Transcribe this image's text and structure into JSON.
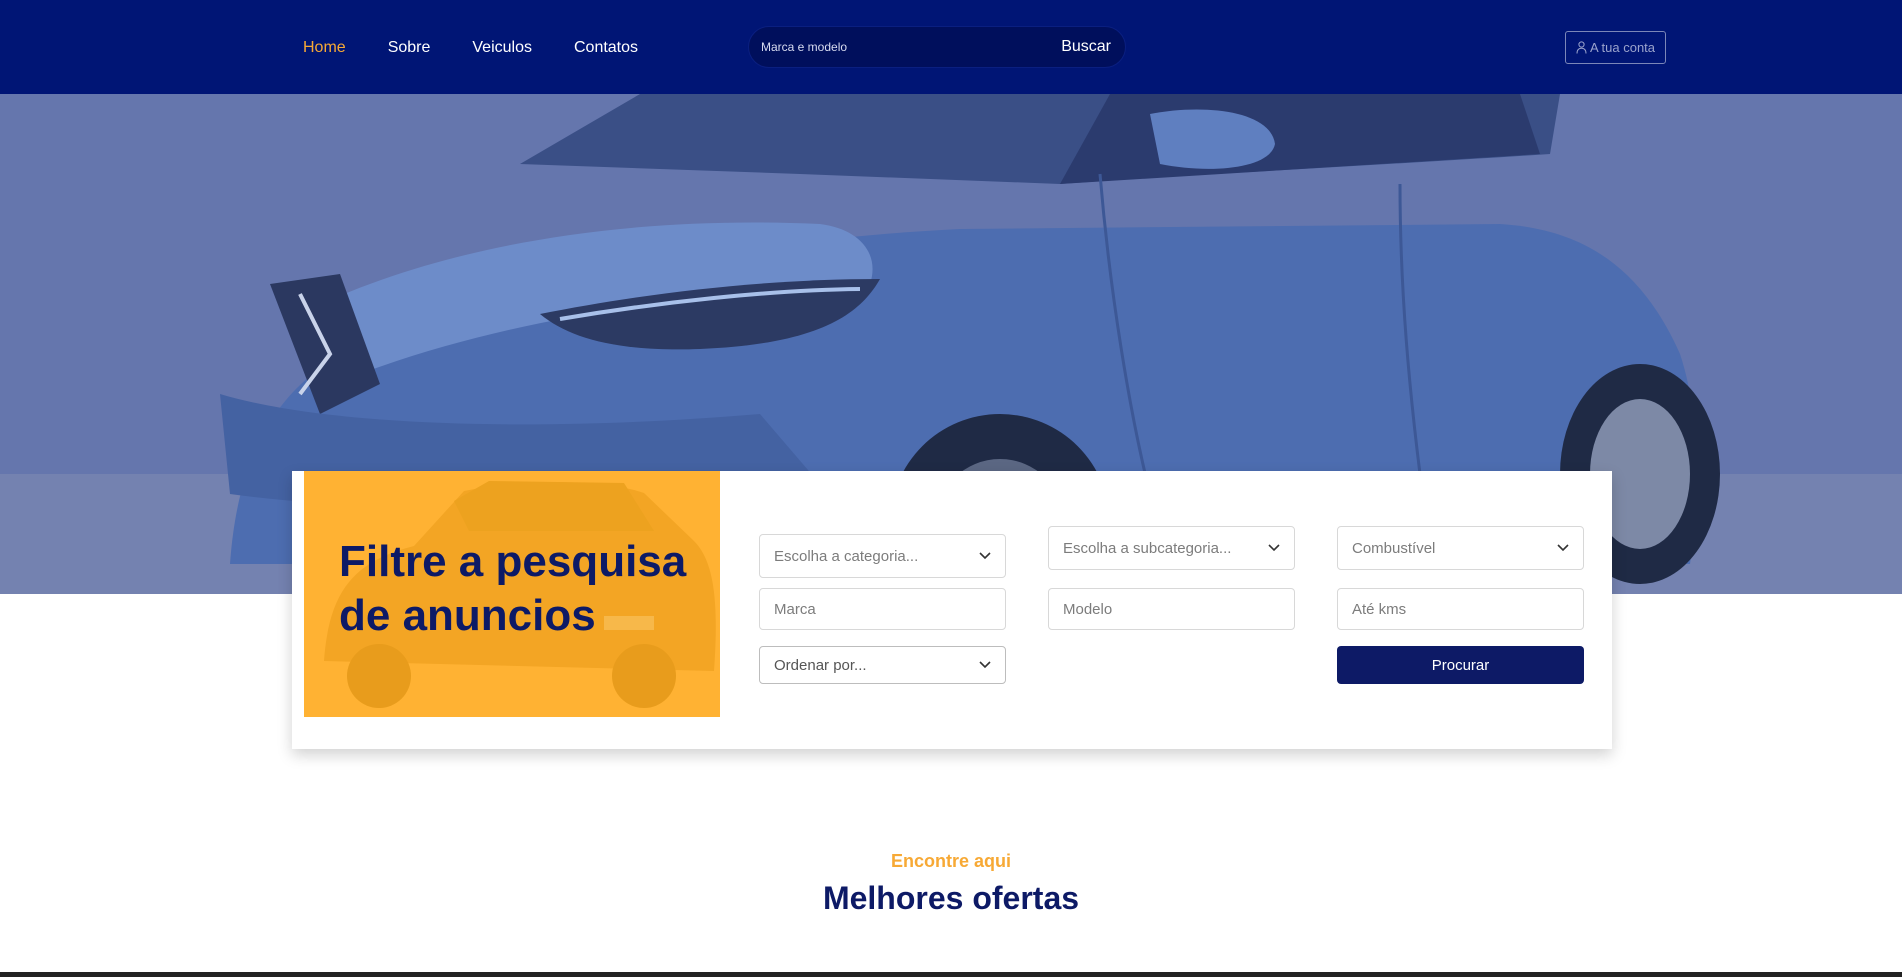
{
  "nav": {
    "items": [
      {
        "label": "Home",
        "active": true
      },
      {
        "label": "Sobre",
        "active": false
      },
      {
        "label": "Veiculos",
        "active": false
      },
      {
        "label": "Contatos",
        "active": false
      }
    ]
  },
  "search": {
    "placeholder": "Marca e modelo",
    "button_label": "Buscar"
  },
  "account": {
    "label": "A tua conta",
    "icon": "user-icon"
  },
  "filter": {
    "title": "Filtre a pesquisa de anuncios",
    "category_placeholder": "Escolha a categoria...",
    "subcategory_placeholder": "Escolha a subcategoria...",
    "fuel_placeholder": "Combustível",
    "brand_placeholder": "Marca",
    "model_placeholder": "Modelo",
    "kms_placeholder": "Até kms",
    "sort_placeholder": "Ordenar por...",
    "submit_label": "Procurar"
  },
  "offers": {
    "eyebrow": "Encontre aqui",
    "title": "Melhores ofertas"
  },
  "colors": {
    "header_bg": "#001575",
    "accent": "#f7a935",
    "promo_bg": "#ffb233",
    "primary_dark": "#0d1a66"
  }
}
